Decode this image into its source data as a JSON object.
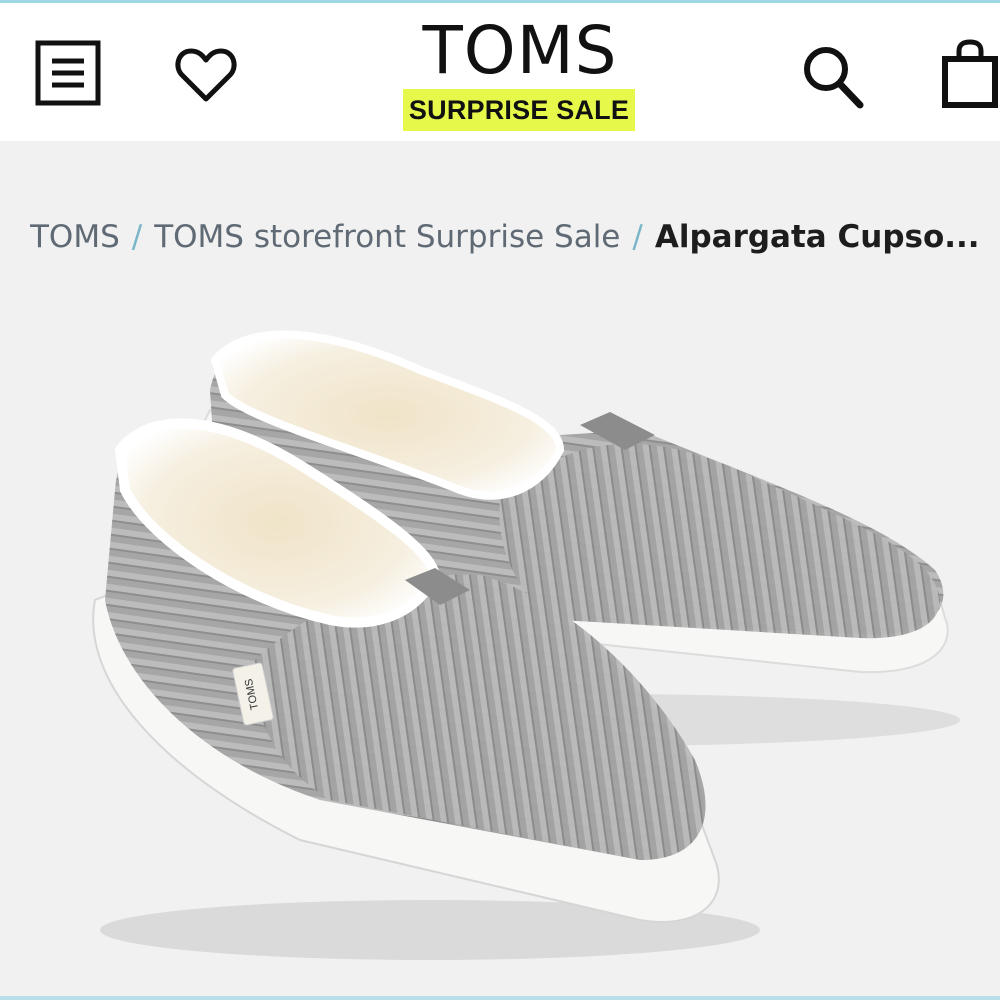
{
  "header": {
    "brand": "TOMS",
    "sale_badge": "SURPRISE SALE",
    "icons": {
      "menu": "menu-icon",
      "wishlist": "heart-icon",
      "search": "search-icon",
      "cart": "shopping-bag-icon"
    }
  },
  "breadcrumb": {
    "items": [
      "TOMS",
      "TOMS storefront Surprise Sale"
    ],
    "separator": "/",
    "current": "Alpargata Cupso..."
  },
  "product": {
    "image_label": "TOMS",
    "colors": {
      "upper": "#a9a9a9",
      "lining": "#f2ead8",
      "sole": "#f7f7f5"
    }
  },
  "colors": {
    "badge": "#e6f94a",
    "breadcrumb_separator": "#7ab6c8",
    "accent_line": "#9fd6e3"
  }
}
